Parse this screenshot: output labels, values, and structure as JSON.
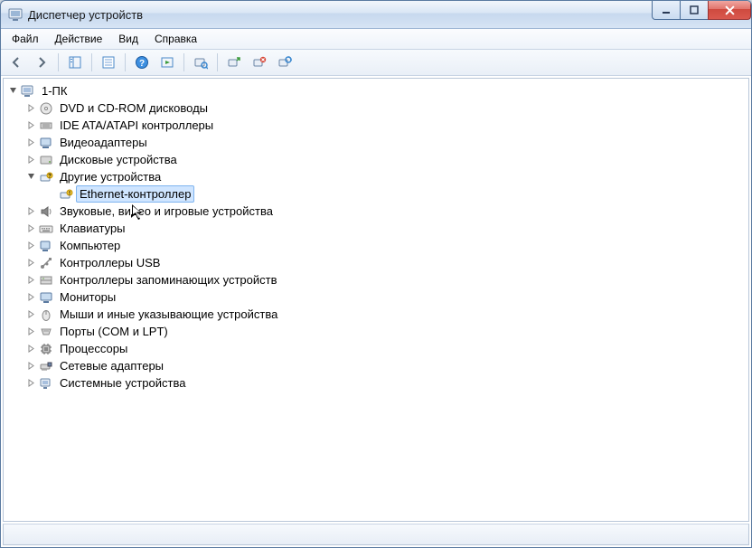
{
  "window": {
    "title": "Диспетчер устройств"
  },
  "menu": {
    "file": "Файл",
    "action": "Действие",
    "view": "Вид",
    "help": "Справка"
  },
  "tree": {
    "root": "1-ПК",
    "dvd": "DVD и CD-ROM дисководы",
    "ide": "IDE ATA/ATAPI контроллеры",
    "video": "Видеоадаптеры",
    "disk": "Дисковые устройства",
    "other": "Другие устройства",
    "ethernet": "Ethernet-контроллер",
    "sound": "Звуковые, видео и игровые устройства",
    "keyboard": "Клавиатуры",
    "computer": "Компьютер",
    "usb": "Контроллеры USB",
    "storage": "Контроллеры запоминающих устройств",
    "monitor": "Мониторы",
    "mouse": "Мыши и иные указывающие устройства",
    "ports": "Порты (COM и LPT)",
    "cpu": "Процессоры",
    "network": "Сетевые адаптеры",
    "system": "Системные устройства"
  }
}
